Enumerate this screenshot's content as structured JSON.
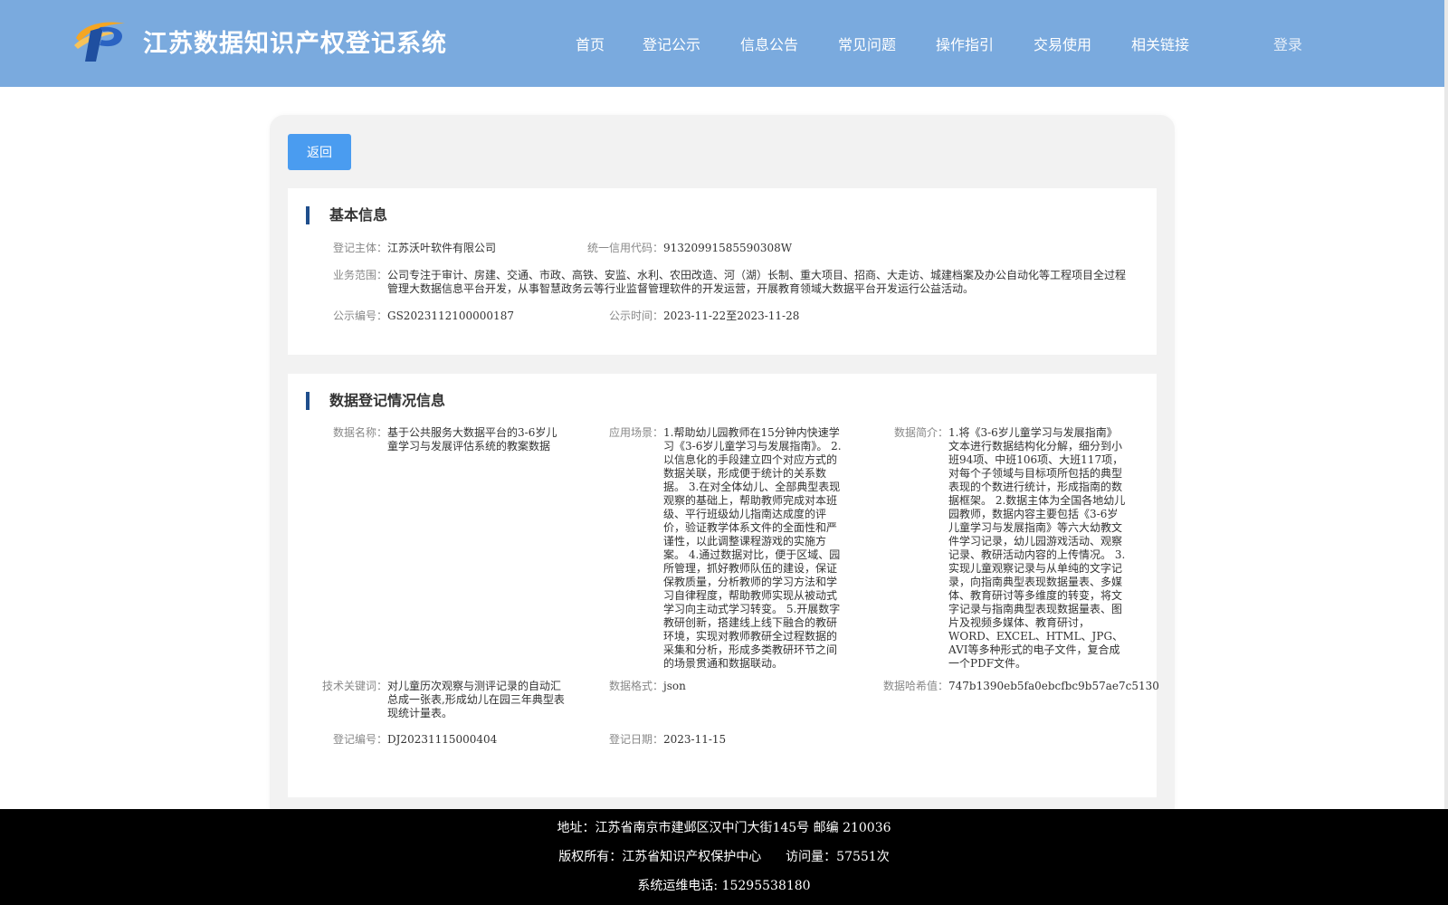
{
  "header": {
    "title": "江苏数据知识产权登记系统",
    "logo_icon": "logo-icon",
    "nav": [
      {
        "label": "首页"
      },
      {
        "label": "登记公示"
      },
      {
        "label": "信息公告"
      },
      {
        "label": "常见问题"
      },
      {
        "label": "操作指引"
      },
      {
        "label": "交易使用"
      },
      {
        "label": "相关链接"
      }
    ],
    "login": "登录",
    "background_color": "#7aaade"
  },
  "actions": {
    "back_label": "返回",
    "back_color": "#4a9cf0"
  },
  "basic_info": {
    "title": "基本信息",
    "entity_label": "登记主体：",
    "entity": "江苏沃叶软件有限公司",
    "credit_label": "统一信用代码：",
    "credit_code": "91320991585590308W",
    "scope_label": "业务范围：",
    "scope": "公司专注于审计、房建、交通、市政、高铁、安监、水利、农田改造、河（湖）长制、重大项目、招商、大走访、城建档案及办公自动化等工程项目全过程管理大数据信息平台开发，从事智慧政务云等行业监督管理软件的开发运营，开展教育领域大数据平台开发运行公益活动。",
    "pub_no_label": "公示编号：",
    "pub_no": "GS2023112100000187",
    "pub_time_label": "公示时间：",
    "pub_time": "2023-11-22至2023-11-28"
  },
  "data_info": {
    "title": "数据登记情况信息",
    "name_label": "数据名称：",
    "name": "基于公共服务大数据平台的3-6岁儿童学习与发展评估系统的教案数据",
    "scene_label": "应用场景：",
    "scene": "1.帮助幼儿园教师在15分钟内快速学习《3-6岁儿童学习与发展指南》。 2.以信息化的手段建立四个对应方式的数据关联，形成便于统计的关系数据。 3.在对全体幼儿、全部典型表现观察的基础上，帮助教师完成对本班级、平行班级幼儿指南达成度的评价，验证教学体系文件的全面性和严谨性，以此调整课程游戏的实施方案。 4.通过数据对比，便于区域、园所管理，抓好教师队伍的建设，保证保教质量，分析教师的学习方法和学习自律程度，帮助教师实现从被动式学习向主动式学习转变。 5.开展数字教研创新，搭建线上线下融合的教研环境，实现对教师教研全过程数据的采集和分析，形成多类教研环节之间的场景贯通和数据联动。",
    "intro_label": "数据简介：",
    "intro": "1.将《3-6岁儿童学习与发展指南》文本进行数据结构化分解，细分到小班94项、中班106项、大班117项，对每个子领域与目标项所包括的典型表现的个数进行统计，形成指南的数据框架。 2.数据主体为全国各地幼儿园教师，数据内容主要包括《3-6岁儿童学习与发展指南》等六大幼教文件学习记录，幼儿园游戏活动、观察记录、教研活动内容的上传情况。 3.实现儿童观察记录与从单纯的文字记录，向指南典型表现数据量表、多媒体、教育研讨等多维度的转变，将文字记录与指南典型表现数据量表、图片及视频多媒体、教育研讨，WORD、EXCEL、HTML、JPG、AVI等多种形式的电子文件，复合成一个PDF文件。",
    "keyword_label": "技术关键词：",
    "keyword": "对儿童历次观察与测评记录的自动汇总成一张表,形成幼儿在园三年典型表现统计量表。",
    "format_label": "数据格式：",
    "format": "json",
    "hash_label": "数据哈希值：",
    "hash": "747b1390eb5fa0ebcfbc9b57ae7c5130",
    "reg_no_label": "登记编号：",
    "reg_no": "DJ20231115000404",
    "reg_date_label": "登记日期：",
    "reg_date": "2023-11-15"
  },
  "footer": {
    "address": "地址：江苏省南京市建邺区汉中门大街145号 邮编 210036",
    "copyright": "版权所有：江苏省知识产权保护中心",
    "visits": "访问量：57551次",
    "phone": "系统运维电话: 15295538180"
  }
}
